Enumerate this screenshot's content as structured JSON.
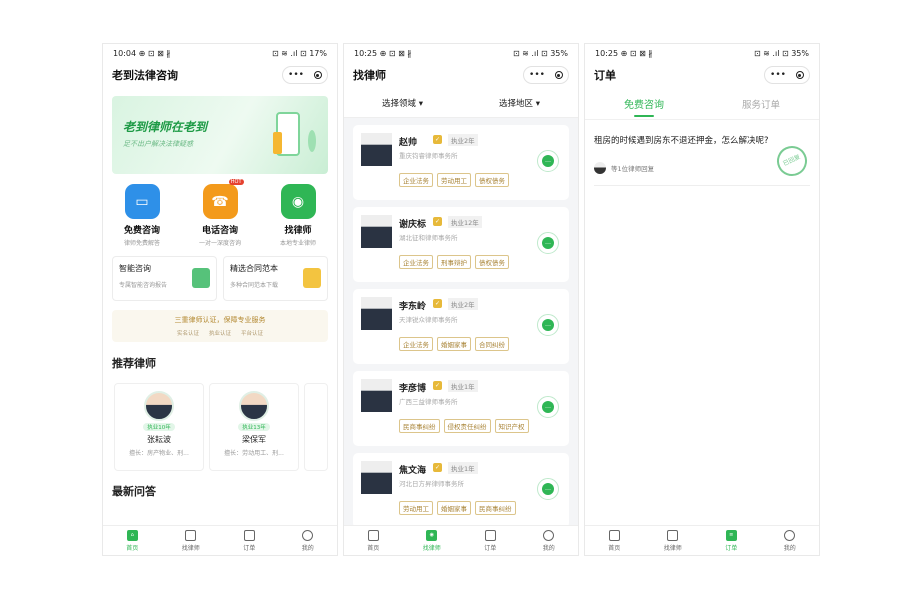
{
  "screen1": {
    "status": {
      "time": "10:04",
      "icons": "⊕ ⊡ ⊠ ∦",
      "right": "⊡ ≋ .ıl ⊡ 17%",
      "battery_pct": 17
    },
    "title": "老到法律咨询",
    "capsule": {
      "more": "•••"
    },
    "banner": {
      "headline": "老到律师在老到",
      "sub": "足不出户解决法律疑惑"
    },
    "services": [
      {
        "name": "免费咨询",
        "sub": "律师免费解答",
        "icon": "chat-icon",
        "color": "#2e90e8"
      },
      {
        "name": "电话咨询",
        "sub": "一对一深度咨询",
        "icon": "phone-icon",
        "color": "#f39a1b",
        "badge": "HOT"
      },
      {
        "name": "找律师",
        "sub": "本地专业律师",
        "icon": "search-icon",
        "color": "#2fb655"
      }
    ],
    "tools": [
      {
        "title": "智能咨询",
        "sub": "专属智能咨询报告",
        "color": "#56c27a"
      },
      {
        "title": "精选合同范本",
        "sub": "多种合同范本下载",
        "color": "#f3c440"
      }
    ],
    "cert": {
      "title": "三重律师认证，保障专业服务",
      "items": [
        "实名认证",
        "执业认证",
        "平台认证"
      ]
    },
    "recommend_title": "推荐律师",
    "lawyers": [
      {
        "years": "执业10年",
        "name": "张耘波",
        "skill": "擅长：房产物业、刑..."
      },
      {
        "years": "执业13年",
        "name": "梁保军",
        "skill": "擅长：劳动用工、刑..."
      }
    ],
    "qa_title": "最新问答",
    "tabs": [
      "首页",
      "找律师",
      "订单",
      "我的"
    ]
  },
  "screen2": {
    "status": {
      "time": "10:25",
      "icons": "⊕ ⊡ ⊠ ∦",
      "right": "⊡ ≋ .ıl ⊡ 35%",
      "battery_pct": 35
    },
    "title": "找律师",
    "capsule": {
      "more": "•••"
    },
    "filters": [
      "选择领域 ▾",
      "选择地区 ▾"
    ],
    "lawyers": [
      {
        "name": "赵帅",
        "verify": "✓",
        "years": "执业2年",
        "firm": "重庆钧睿律师事务所",
        "tags": [
          "企业法务",
          "劳动用工",
          "债权债务"
        ]
      },
      {
        "name": "谢庆标",
        "verify": "✓",
        "years": "执业12年",
        "firm": "湖北征和律师事务所",
        "tags": [
          "企业法务",
          "刑事辩护",
          "债权债务"
        ]
      },
      {
        "name": "李东岭",
        "verify": "✓",
        "years": "执业2年",
        "firm": "天津锐众律师事务所",
        "tags": [
          "企业法务",
          "婚姻家事",
          "合同纠纷"
        ]
      },
      {
        "name": "李彦博",
        "verify": "✓",
        "years": "执业1年",
        "firm": "广西三益律师事务所",
        "tags": [
          "民商事纠纷",
          "侵权责任纠纷",
          "知识产权"
        ]
      },
      {
        "name": "焦文海",
        "verify": "✓",
        "years": "执业1年",
        "firm": "河北日方昇律师事务所",
        "tags": [
          "劳动用工",
          "婚姻家事",
          "民商事纠纷"
        ]
      }
    ],
    "tabs": [
      "首页",
      "找律师",
      "订单",
      "我的"
    ]
  },
  "screen3": {
    "status": {
      "time": "10:25",
      "icons": "⊕ ⊡ ⊠ ∦",
      "right": "⊡ ≋ .ıl ⊡ 35%",
      "battery_pct": 35
    },
    "title": "订单",
    "capsule": {
      "more": "•••"
    },
    "order_tabs": [
      "免费咨询",
      "服务订单"
    ],
    "order": {
      "question": "租房的时候遇到房东不退还押金，怎么解决呢?",
      "waiting": "等1位律师回复",
      "stamp": "已回复"
    },
    "tabs": [
      "首页",
      "找律师",
      "订单",
      "我的"
    ]
  }
}
